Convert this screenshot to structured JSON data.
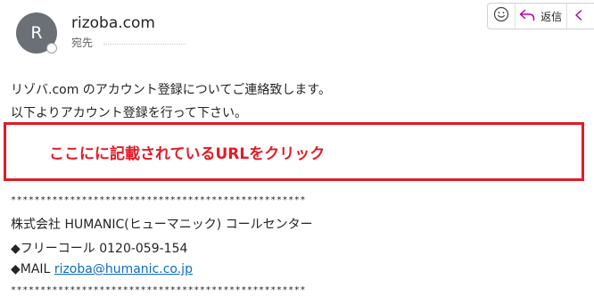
{
  "header": {
    "avatar_initial": "R",
    "sender": "rizoba.com",
    "to_label": "宛先"
  },
  "toolbar": {
    "emoji_icon": "smiley-icon",
    "reply_icon": "reply-arrow-icon",
    "reply_label": "返信",
    "reply_all_icon": "reply-all-icon",
    "accent_color": "#b4009e"
  },
  "body": {
    "line1": "リゾバ.com のアカウント登録についてご連絡致します。",
    "line2": "以下よりアカウント登録を行って下さい。",
    "callout": "ここにに記載されているURLをクリック",
    "callout_color": "#e21b26",
    "separator": "**************************************************",
    "company": "株式会社 HUMANIC(ヒューマニック) コールセンター",
    "freecall": "◆フリーコール 0120-059-154",
    "mail_label": "◆MAIL ",
    "mail_link": "rizoba@humanic.co.jp"
  }
}
